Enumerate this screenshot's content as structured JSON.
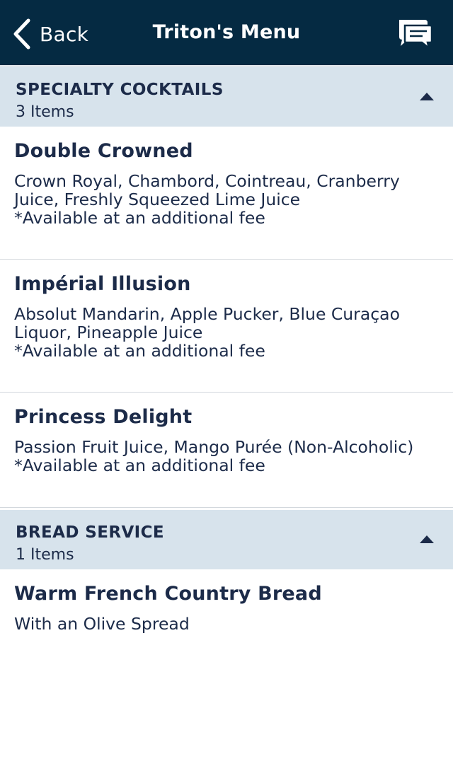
{
  "nav": {
    "back_label": "Back",
    "title": "Triton's Menu",
    "chat_icon": "chat-bubble-icon",
    "background": "#052a42"
  },
  "sections": [
    {
      "title": "SPECIALTY COCKTAILS",
      "count": "3 Items",
      "expanded": true,
      "items": [
        {
          "name": "Double Crowned",
          "desc_lines": [
            "Crown Royal, Chambord, Cointreau, Cranberry",
            "Juice, Freshly Squeezed Lime Juice"
          ],
          "fee": "*Available at an additional fee"
        },
        {
          "name": "Impérial Illusion",
          "desc_lines": [
            "Absolut Mandarin, Apple Pucker, Blue Curaçao",
            "Liquor, Pineapple Juice"
          ],
          "fee": "*Available at an additional fee"
        },
        {
          "name": "Princess Delight",
          "desc_lines": [
            "Passion Fruit Juice, Mango Purée (Non-Alcoholic)"
          ],
          "fee": "*Available at an additional fee"
        }
      ]
    },
    {
      "title": "BREAD SERVICE",
      "count": "1 Items",
      "expanded": true,
      "items": [
        {
          "name": "Warm French Country Bread",
          "desc_lines": [
            "With an Olive Spread"
          ]
        }
      ]
    }
  ],
  "colors": {
    "header_bg": "#d7e3ec",
    "text": "#1c2b49",
    "divider": "#d3d8dd"
  }
}
